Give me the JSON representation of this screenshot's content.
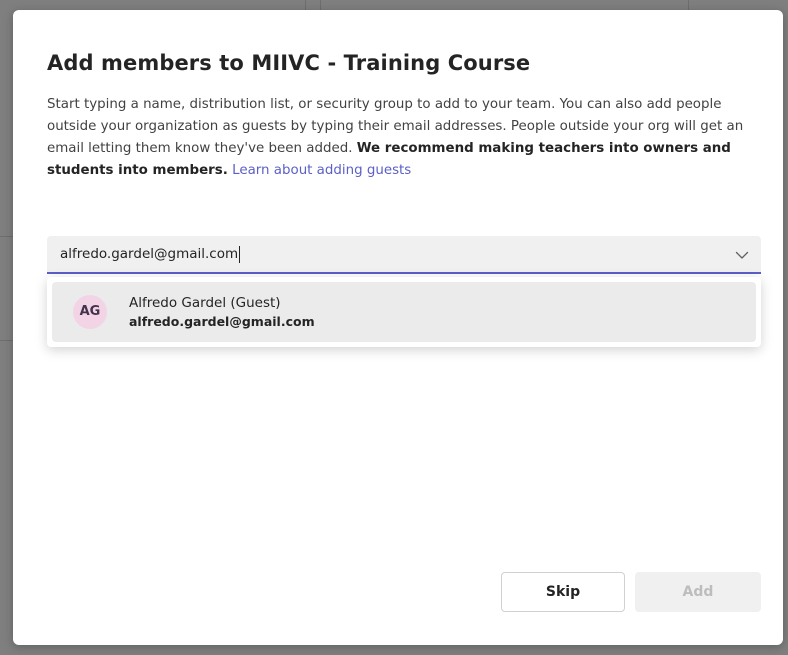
{
  "dialog": {
    "title": "Add members to MIIVC - Training Course",
    "description": {
      "part1": "Start typing a name, distribution list, or security group to add to your team. You can also add people outside your organization as guests by typing their email addresses. People outside your org will get an email letting them know they've been added. ",
      "bold": "We recommend making teachers into owners and students into members.",
      "link": "Learn about adding guests"
    }
  },
  "picker": {
    "value": "alfredo.gardel@gmail.com",
    "chevron_icon": "chevron-down-icon"
  },
  "suggestions": [
    {
      "initials": "AG",
      "name": "Alfredo Gardel (Guest)",
      "email": "alfredo.gardel@gmail.com",
      "avatar_color": "#f2d4e6"
    }
  ],
  "buttons": {
    "skip": "Skip",
    "add": "Add"
  },
  "colors": {
    "accent": "#5b5fc7",
    "overlay": "#8a8a8a"
  }
}
